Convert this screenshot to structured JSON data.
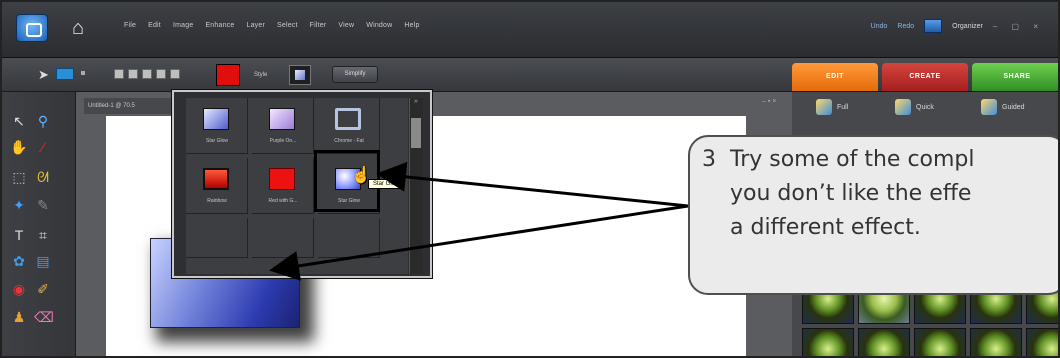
{
  "menubar": {
    "items": [
      "File",
      "Edit",
      "Image",
      "Enhance",
      "Layer",
      "Select",
      "Filter",
      "View",
      "Window",
      "Help"
    ],
    "undo": "Undo",
    "redo": "Redo",
    "organizer": "Organizer",
    "window_controls": "– ▢ ×"
  },
  "options": {
    "style_label": "Style",
    "simplify": "Simplify",
    "color": "#e20e0e"
  },
  "tabs": {
    "edit": "EDIT",
    "create": "CREATE",
    "share": "SHARE"
  },
  "document": {
    "tab_title": "Untitled-1 @ 70.5"
  },
  "edit_modes": [
    "Full",
    "Quick",
    "Guided"
  ],
  "styles_popup": {
    "swatches": [
      {
        "label": "Star Glow",
        "color": "#7788dd"
      },
      {
        "label": "Purple On...",
        "color": "#b9a2e6"
      },
      {
        "label": "Chrome - Fat",
        "color": "#8fa2c9"
      },
      {
        "label": "Rainbow",
        "color": "#e62d1f"
      },
      {
        "label": "Red with G...",
        "color": "#ee1111"
      },
      {
        "label": "Star Glow",
        "color": "#aab6ff"
      }
    ],
    "tooltip": "Star Glow"
  },
  "callout": {
    "number": "3",
    "line1": "Try some of the compl",
    "line2": "you don’t like the effe",
    "line3": "a different effect."
  }
}
